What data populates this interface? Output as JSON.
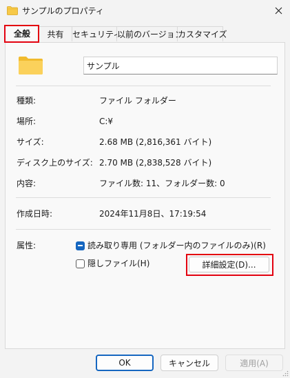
{
  "window": {
    "title": "サンプルのプロパティ",
    "folder_color": "#f7c948"
  },
  "tabs": [
    {
      "label": "全般",
      "active": true
    },
    {
      "label": "共有",
      "active": false
    },
    {
      "label": "セキュリティ",
      "active": false
    },
    {
      "label": "以前のバージョン",
      "active": false
    },
    {
      "label": "カスタマイズ",
      "active": false
    }
  ],
  "general": {
    "folder_name": "サンプル",
    "rows": [
      {
        "label": "種類:",
        "value": "ファイル フォルダー"
      },
      {
        "label": "場所:",
        "value": "C:¥"
      },
      {
        "label": "サイズ:",
        "value": "2.68 MB (2,816,361 バイト)"
      },
      {
        "label": "ディスク上のサイズ:",
        "value": "2.70 MB (2,838,528 バイト)"
      },
      {
        "label": "内容:",
        "value": "ファイル数: 11、フォルダー数: 0"
      },
      {
        "label": "作成日時:",
        "value": "2024年11月8日、17:19:54"
      }
    ],
    "attributes_label": "属性:",
    "readonly_label": "読み取り専用 (フォルダー内のファイルのみ)(R)",
    "readonly_state": "indeterminate",
    "hidden_label": "隠しファイル(H)",
    "hidden_state": "unchecked",
    "advanced_label": "詳細設定(D)..."
  },
  "buttons": {
    "ok": "OK",
    "cancel": "キャンセル",
    "apply": "適用(A)",
    "apply_enabled": false
  },
  "colors": {
    "accent": "#1566c0",
    "highlight": "#e3000f"
  }
}
